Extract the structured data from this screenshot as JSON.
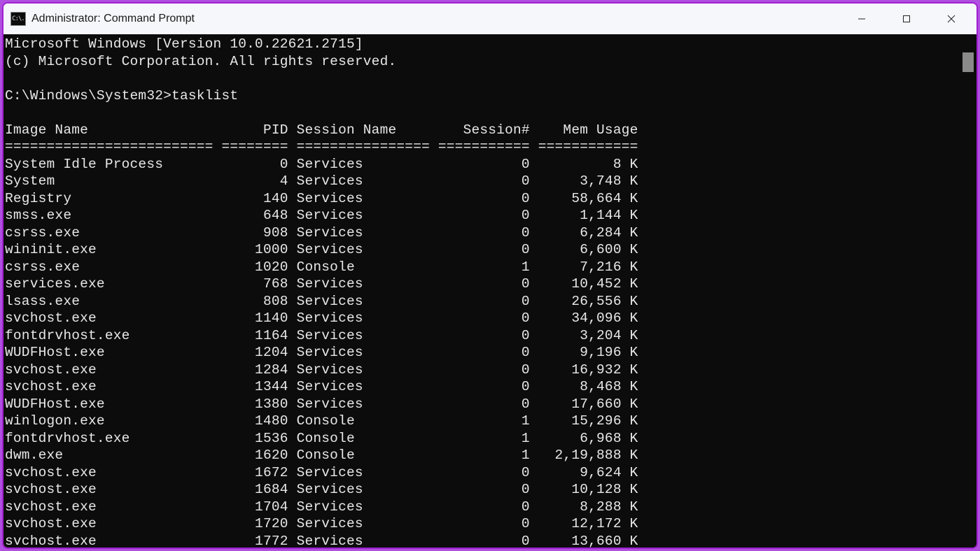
{
  "window": {
    "title": "Administrator: Command Prompt",
    "icon_text": "C:\\."
  },
  "banner": {
    "line1": "Microsoft Windows [Version 10.0.22621.2715]",
    "line2": "(c) Microsoft Corporation. All rights reserved."
  },
  "prompt": {
    "path": "C:\\Windows\\System32>",
    "command": "tasklist"
  },
  "headers": {
    "image_name": "Image Name",
    "pid": "PID",
    "session_name": "Session Name",
    "session_num": "Session#",
    "mem_usage": "Mem Usage"
  },
  "separator": "========================= ======== ================ =========== ============",
  "processes": [
    {
      "name": "System Idle Process",
      "pid": 0,
      "session_name": "Services",
      "session": 0,
      "mem": "8 K"
    },
    {
      "name": "System",
      "pid": 4,
      "session_name": "Services",
      "session": 0,
      "mem": "3,748 K"
    },
    {
      "name": "Registry",
      "pid": 140,
      "session_name": "Services",
      "session": 0,
      "mem": "58,664 K"
    },
    {
      "name": "smss.exe",
      "pid": 648,
      "session_name": "Services",
      "session": 0,
      "mem": "1,144 K"
    },
    {
      "name": "csrss.exe",
      "pid": 908,
      "session_name": "Services",
      "session": 0,
      "mem": "6,284 K"
    },
    {
      "name": "wininit.exe",
      "pid": 1000,
      "session_name": "Services",
      "session": 0,
      "mem": "6,600 K"
    },
    {
      "name": "csrss.exe",
      "pid": 1020,
      "session_name": "Console",
      "session": 1,
      "mem": "7,216 K"
    },
    {
      "name": "services.exe",
      "pid": 768,
      "session_name": "Services",
      "session": 0,
      "mem": "10,452 K"
    },
    {
      "name": "lsass.exe",
      "pid": 808,
      "session_name": "Services",
      "session": 0,
      "mem": "26,556 K"
    },
    {
      "name": "svchost.exe",
      "pid": 1140,
      "session_name": "Services",
      "session": 0,
      "mem": "34,096 K"
    },
    {
      "name": "fontdrvhost.exe",
      "pid": 1164,
      "session_name": "Services",
      "session": 0,
      "mem": "3,204 K"
    },
    {
      "name": "WUDFHost.exe",
      "pid": 1204,
      "session_name": "Services",
      "session": 0,
      "mem": "9,196 K"
    },
    {
      "name": "svchost.exe",
      "pid": 1284,
      "session_name": "Services",
      "session": 0,
      "mem": "16,932 K"
    },
    {
      "name": "svchost.exe",
      "pid": 1344,
      "session_name": "Services",
      "session": 0,
      "mem": "8,468 K"
    },
    {
      "name": "WUDFHost.exe",
      "pid": 1380,
      "session_name": "Services",
      "session": 0,
      "mem": "17,660 K"
    },
    {
      "name": "winlogon.exe",
      "pid": 1480,
      "session_name": "Console",
      "session": 1,
      "mem": "15,296 K"
    },
    {
      "name": "fontdrvhost.exe",
      "pid": 1536,
      "session_name": "Console",
      "session": 1,
      "mem": "6,968 K"
    },
    {
      "name": "dwm.exe",
      "pid": 1620,
      "session_name": "Console",
      "session": 1,
      "mem": "2,19,888 K"
    },
    {
      "name": "svchost.exe",
      "pid": 1672,
      "session_name": "Services",
      "session": 0,
      "mem": "9,624 K"
    },
    {
      "name": "svchost.exe",
      "pid": 1684,
      "session_name": "Services",
      "session": 0,
      "mem": "10,128 K"
    },
    {
      "name": "svchost.exe",
      "pid": 1704,
      "session_name": "Services",
      "session": 0,
      "mem": "8,288 K"
    },
    {
      "name": "svchost.exe",
      "pid": 1720,
      "session_name": "Services",
      "session": 0,
      "mem": "12,172 K"
    },
    {
      "name": "svchost.exe",
      "pid": 1772,
      "session_name": "Services",
      "session": 0,
      "mem": "13,660 K"
    }
  ],
  "col_widths": {
    "name": 25,
    "pid": 8,
    "session_name": 16,
    "session": 11,
    "mem": 12
  }
}
